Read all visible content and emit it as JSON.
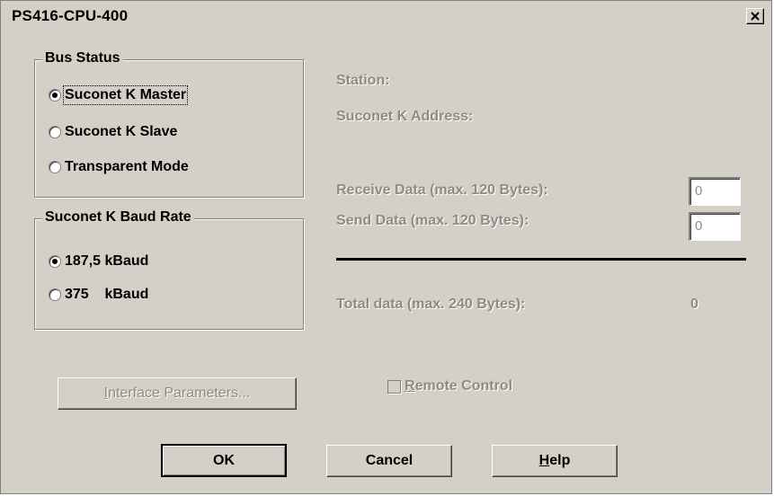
{
  "window": {
    "title": "PS416-CPU-400",
    "close_icon": "close-icon"
  },
  "bus_status": {
    "title": "Bus Status",
    "options": [
      {
        "label": "Suconet K Master",
        "checked": true
      },
      {
        "label": "Suconet K Slave",
        "checked": false
      },
      {
        "label": "Transparent Mode",
        "checked": false
      }
    ]
  },
  "baud_rate": {
    "title": "Suconet K Baud Rate",
    "options": [
      {
        "label": "187,5 kBaud",
        "checked": true
      },
      {
        "label": "375    kBaud",
        "checked": false
      }
    ]
  },
  "info": {
    "station_label": "Station:",
    "address_label": "Suconet K Address:",
    "receive_label": "Receive Data (max. 120 Bytes):",
    "receive_value": "0",
    "send_label": "Send Data (max. 120 Bytes):",
    "send_value": "0",
    "total_label": "Total data (max. 240 Bytes):",
    "total_value": "0"
  },
  "interface_button": {
    "first": "I",
    "rest": "nterface Parameters..."
  },
  "remote_control": {
    "first": "R",
    "rest": "emote Control",
    "checked": false
  },
  "buttons": {
    "ok": "OK",
    "cancel": "Cancel",
    "help_first": "H",
    "help_rest": "elp"
  }
}
